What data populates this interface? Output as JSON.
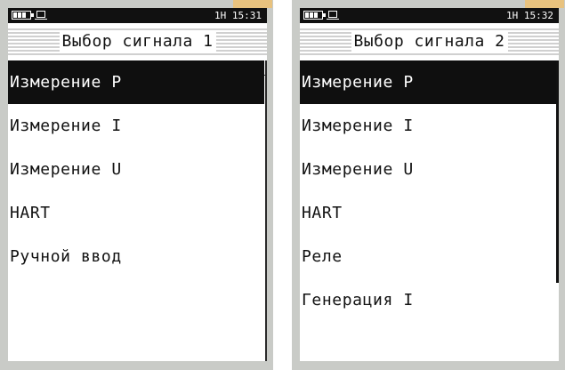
{
  "screens": [
    {
      "status_time": "1H 15:31",
      "title": "Выбор сигнала 1",
      "menu_items": [
        "Измерение P",
        "Измерение I",
        "Измерение U",
        "HART",
        "Ручной ввод"
      ],
      "selected_index": 0
    },
    {
      "status_time": "1H 15:32",
      "title": "Выбор сигнала 2",
      "menu_items": [
        "Измерение P",
        "Измерение I",
        "Измерение U",
        "HART",
        "Реле",
        "Генерация I"
      ],
      "selected_index": 0
    }
  ],
  "colors": {
    "device_frame": "#c9cbc7",
    "status_bar": "#111111",
    "selection": "#0f0f0f",
    "accent_tab": "#e8c27e"
  },
  "icons": [
    "battery-icon",
    "connection-icon"
  ]
}
